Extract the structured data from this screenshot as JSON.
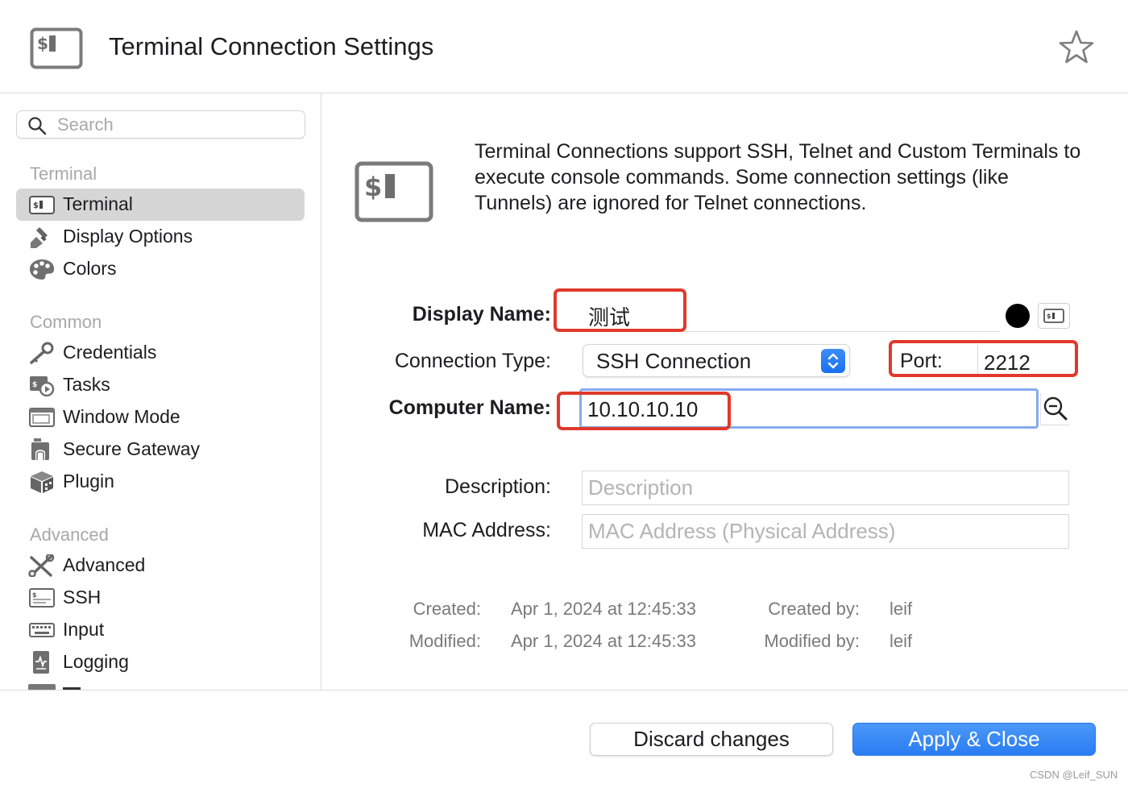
{
  "window": {
    "title": "Terminal Connection Settings"
  },
  "sidebar": {
    "search_placeholder": "Search",
    "groups": [
      {
        "label": "Terminal",
        "items": [
          {
            "label": "Terminal",
            "icon": "terminal-icon",
            "selected": true
          },
          {
            "label": "Display Options",
            "icon": "brush-icon"
          },
          {
            "label": "Colors",
            "icon": "palette-icon"
          }
        ]
      },
      {
        "label": "Common",
        "items": [
          {
            "label": "Credentials",
            "icon": "key-icon"
          },
          {
            "label": "Tasks",
            "icon": "tasks-icon"
          },
          {
            "label": "Window Mode",
            "icon": "window-icon"
          },
          {
            "label": "Secure Gateway",
            "icon": "gateway-icon"
          },
          {
            "label": "Plugin",
            "icon": "plugin-icon"
          }
        ]
      },
      {
        "label": "Advanced",
        "items": [
          {
            "label": "Advanced",
            "icon": "tools-icon"
          },
          {
            "label": "SSH",
            "icon": "ssh-icon"
          },
          {
            "label": "Input",
            "icon": "keyboard-icon"
          },
          {
            "label": "Logging",
            "icon": "logging-icon"
          }
        ]
      }
    ]
  },
  "main": {
    "intro": "Terminal Connections support SSH, Telnet and Custom Terminals to execute console commands. Some connection settings (like Tunnels) are ignored for Telnet connections.",
    "display_name": {
      "label": "Display Name:",
      "value": "测试"
    },
    "connection_type": {
      "label": "Connection Type:",
      "value": "SSH Connection"
    },
    "port": {
      "label": "Port:",
      "value": "2212"
    },
    "computer_name": {
      "label": "Computer Name:",
      "value": "10.10.10.10"
    },
    "description": {
      "label": "Description:",
      "placeholder": "Description"
    },
    "mac_address": {
      "label": "MAC Address:",
      "placeholder": "MAC Address (Physical Address)"
    },
    "meta": {
      "created_label": "Created:",
      "created_value": "Apr 1, 2024 at 12:45:33",
      "created_by_label": "Created by:",
      "created_by_value": "leif",
      "modified_label": "Modified:",
      "modified_value": "Apr 1, 2024 at 12:45:33",
      "modified_by_label": "Modified by:",
      "modified_by_value": "leif"
    }
  },
  "footer": {
    "discard_label": "Discard changes",
    "apply_label": "Apply & Close"
  },
  "watermark": "CSDN @Leif_SUN",
  "colors": {
    "accent": "#2a7cf2",
    "annotation": "#e0392b",
    "focus": "#86abf0"
  }
}
